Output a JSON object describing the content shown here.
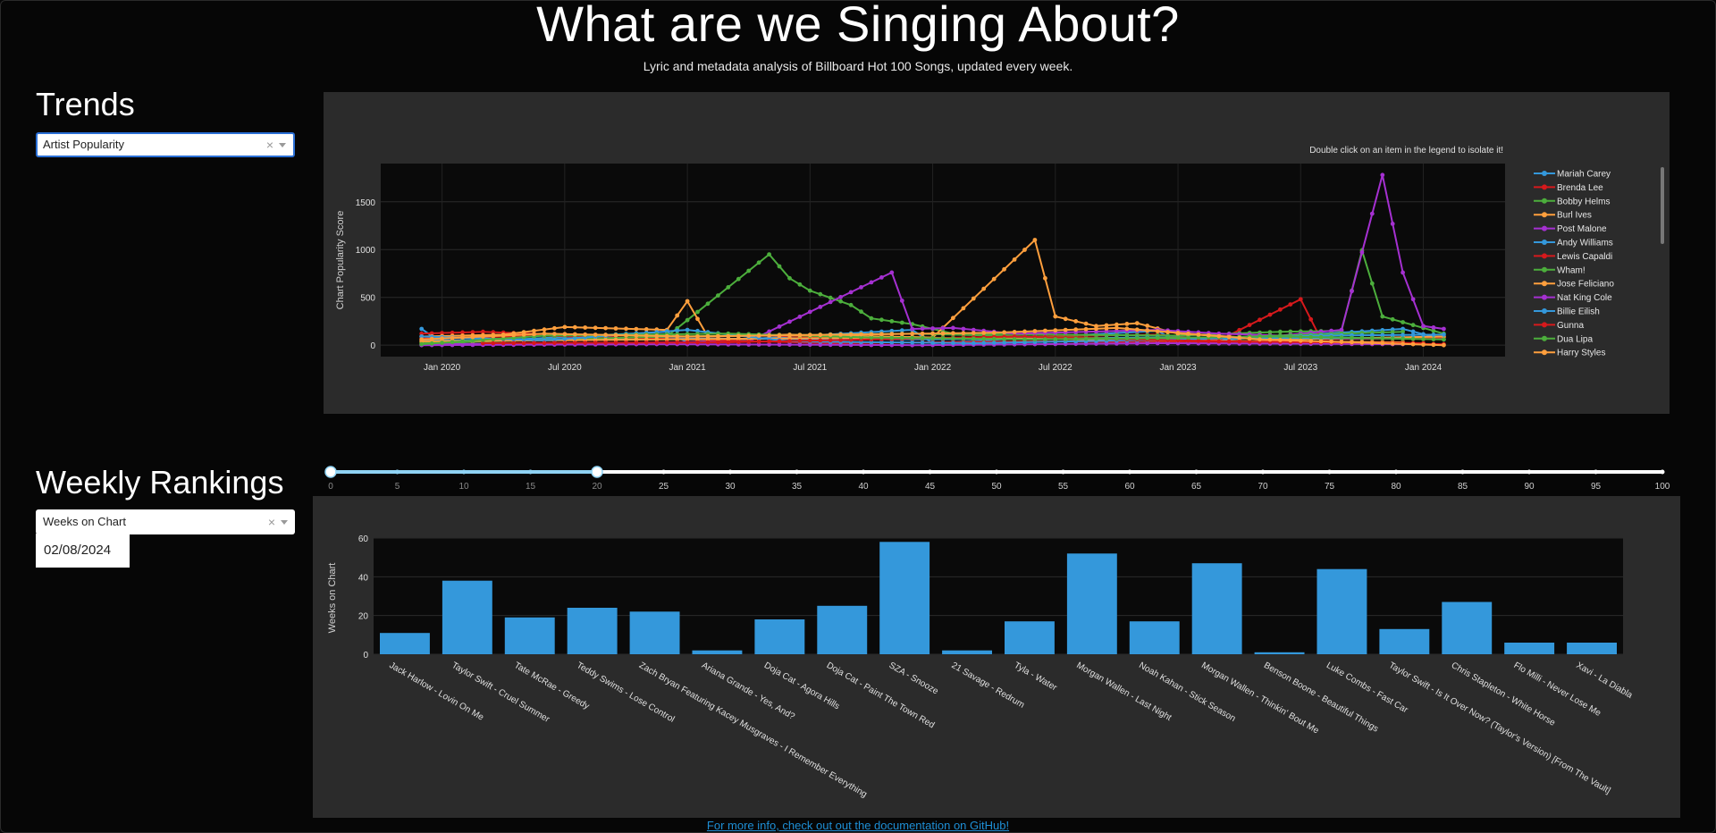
{
  "header": {
    "title": "What are we Singing About?",
    "subtitle": "Lyric and metadata analysis of Billboard Hot 100 Songs, updated every week."
  },
  "trends": {
    "heading": "Trends",
    "dropdown": {
      "value": "Artist Popularity",
      "clear_icon": "×"
    }
  },
  "weekly": {
    "heading": "Weekly Rankings",
    "dropdown": {
      "value": "Weeks on Chart",
      "clear_icon": "×"
    },
    "date": "02/08/2024"
  },
  "slider": {
    "min": 0,
    "max": 100,
    "selected_range": [
      0,
      20
    ],
    "marks": [
      "0",
      "5",
      "10",
      "15",
      "20",
      "25",
      "30",
      "35",
      "40",
      "45",
      "50",
      "55",
      "60",
      "65",
      "70",
      "75",
      "80",
      "85",
      "90",
      "95",
      "100"
    ]
  },
  "footer": {
    "link_text": "For more info, check out out the documentation on GitHub!"
  },
  "colors": {
    "blue": "#3498db",
    "red": "#d7191c",
    "green": "#4cae3c",
    "orange": "#ff9f3d",
    "purple": "#a530d1",
    "accent": "#1e8fd6"
  },
  "chart_data": [
    {
      "type": "line",
      "annotation": "Double click on an item in the legend to isolate it!",
      "ylabel": "Chart Popularity Score",
      "xlabel": "",
      "x_ticks": [
        "Jan 2020",
        "Jul 2020",
        "Jan 2021",
        "Jul 2021",
        "Jan 2022",
        "Jul 2022",
        "Jan 2023",
        "Jul 2023",
        "Jan 2024"
      ],
      "y_ticks": [
        "0",
        "500",
        "1000",
        "1500"
      ],
      "ylim": [
        -120,
        1900
      ],
      "x_range_months": [
        "2019-10",
        "2024-05"
      ],
      "legend_position": "right",
      "series": [
        {
          "name": "Mariah Carey",
          "color": "#3498db",
          "points": [
            [
              "2019-12",
              170
            ],
            [
              "2020-01",
              20
            ],
            [
              "2020-12",
              140
            ],
            [
              "2021-01",
              30
            ],
            [
              "2021-12",
              160
            ],
            [
              "2022-01",
              20
            ],
            [
              "2022-12",
              150
            ],
            [
              "2023-01",
              30
            ],
            [
              "2023-12",
              170
            ],
            [
              "2024-02",
              60
            ]
          ]
        },
        {
          "name": "Brenda Lee",
          "color": "#d7191c",
          "points": [
            [
              "2019-12",
              120
            ],
            [
              "2020-03",
              140
            ],
            [
              "2020-10",
              80
            ],
            [
              "2021-05",
              100
            ],
            [
              "2021-11",
              60
            ],
            [
              "2022-06",
              90
            ],
            [
              "2022-12",
              110
            ],
            [
              "2023-03",
              50
            ],
            [
              "2023-07",
              480
            ],
            [
              "2023-08",
              60
            ],
            [
              "2024-02",
              80
            ]
          ]
        },
        {
          "name": "Bobby Helms",
          "color": "#4cae3c",
          "points": [
            [
              "2019-12",
              30
            ],
            [
              "2020-06",
              60
            ],
            [
              "2020-12",
              90
            ],
            [
              "2021-05",
              950
            ],
            [
              "2021-06",
              700
            ],
            [
              "2021-07",
              570
            ],
            [
              "2021-09",
              420
            ],
            [
              "2021-10",
              280
            ],
            [
              "2021-12",
              220
            ],
            [
              "2022-02",
              120
            ],
            [
              "2022-07",
              110
            ],
            [
              "2023-01",
              100
            ],
            [
              "2023-06",
              140
            ],
            [
              "2023-09",
              150
            ],
            [
              "2023-10",
              990
            ],
            [
              "2023-11",
              300
            ],
            [
              "2024-02",
              120
            ]
          ]
        },
        {
          "name": "Burl Ives",
          "color": "#ff9f3d",
          "points": [
            [
              "2019-12",
              90
            ],
            [
              "2020-04",
              110
            ],
            [
              "2020-07",
              190
            ],
            [
              "2020-12",
              160
            ],
            [
              "2021-01",
              460
            ],
            [
              "2021-02",
              90
            ],
            [
              "2021-06",
              110
            ],
            [
              "2022-01",
              80
            ],
            [
              "2022-06",
              1100
            ],
            [
              "2022-07",
              300
            ],
            [
              "2022-09",
              200
            ],
            [
              "2022-11",
              230
            ],
            [
              "2023-01",
              120
            ],
            [
              "2023-06",
              60
            ],
            [
              "2024-02",
              90
            ]
          ]
        },
        {
          "name": "Post Malone",
          "color": "#a530d1",
          "points": [
            [
              "2019-12",
              10
            ],
            [
              "2020-09",
              20
            ],
            [
              "2021-04",
              40
            ],
            [
              "2021-11",
              760
            ],
            [
              "2021-12",
              170
            ],
            [
              "2022-02",
              180
            ],
            [
              "2022-05",
              120
            ],
            [
              "2022-12",
              160
            ],
            [
              "2023-03",
              120
            ],
            [
              "2023-06",
              100
            ],
            [
              "2023-09",
              160
            ],
            [
              "2023-11",
              1780
            ],
            [
              "2023-12",
              760
            ],
            [
              "2024-01",
              200
            ],
            [
              "2024-02",
              170
            ]
          ]
        },
        {
          "name": "Andy Williams",
          "color": "#3498db",
          "points": [
            [
              "2019-12",
              50
            ],
            [
              "2020-12",
              70
            ],
            [
              "2021-12",
              60
            ],
            [
              "2022-12",
              80
            ],
            [
              "2023-12",
              70
            ]
          ]
        },
        {
          "name": "Lewis Capaldi",
          "color": "#d7191c",
          "points": [
            [
              "2019-12",
              70
            ],
            [
              "2020-06",
              100
            ],
            [
              "2021-01",
              60
            ],
            [
              "2021-08",
              20
            ],
            [
              "2022-06",
              40
            ],
            [
              "2023-02",
              30
            ],
            [
              "2024-02",
              10
            ]
          ]
        },
        {
          "name": "Wham!",
          "color": "#4cae3c",
          "points": [
            [
              "2019-12",
              20
            ],
            [
              "2020-12",
              90
            ],
            [
              "2021-12",
              120
            ],
            [
              "2022-12",
              60
            ],
            [
              "2023-12",
              140
            ]
          ]
        },
        {
          "name": "Jose Feliciano",
          "color": "#ff9f3d",
          "points": [
            [
              "2019-12",
              40
            ],
            [
              "2020-12",
              60
            ],
            [
              "2021-12",
              80
            ],
            [
              "2022-12",
              50
            ],
            [
              "2023-12",
              30
            ]
          ]
        },
        {
          "name": "Nat King Cole",
          "color": "#a530d1",
          "points": [
            [
              "2019-12",
              0
            ],
            [
              "2020-12",
              10
            ],
            [
              "2021-12",
              0
            ],
            [
              "2022-12",
              20
            ],
            [
              "2023-12",
              10
            ]
          ]
        },
        {
          "name": "Billie Eilish",
          "color": "#3498db",
          "points": [
            [
              "2019-12",
              90
            ],
            [
              "2020-06",
              50
            ],
            [
              "2021-01",
              160
            ],
            [
              "2021-06",
              40
            ],
            [
              "2022-03",
              20
            ],
            [
              "2023-01",
              60
            ],
            [
              "2023-08",
              100
            ],
            [
              "2024-02",
              110
            ]
          ]
        },
        {
          "name": "Gunna",
          "color": "#d7191c",
          "points": [
            [
              "2020-03",
              20
            ],
            [
              "2021-03",
              30
            ],
            [
              "2022-05",
              90
            ],
            [
              "2023-03",
              40
            ],
            [
              "2024-01",
              20
            ]
          ]
        },
        {
          "name": "Dua Lipa",
          "color": "#4cae3c",
          "points": [
            [
              "2019-12",
              10
            ],
            [
              "2020-06",
              100
            ],
            [
              "2021-03",
              120
            ],
            [
              "2021-10",
              80
            ],
            [
              "2022-06",
              60
            ],
            [
              "2023-06",
              90
            ],
            [
              "2024-02",
              60
            ]
          ]
        },
        {
          "name": "Harry Styles",
          "color": "#ff9f3d",
          "points": [
            [
              "2019-12",
              60
            ],
            [
              "2020-06",
              120
            ],
            [
              "2021-01",
              90
            ],
            [
              "2022-04",
              130
            ],
            [
              "2022-10",
              180
            ],
            [
              "2023-05",
              60
            ],
            [
              "2024-02",
              0
            ]
          ]
        }
      ]
    },
    {
      "type": "bar",
      "ylabel": "Weeks on Chart",
      "xlabel": "",
      "y_ticks": [
        "0",
        "20",
        "40",
        "60"
      ],
      "ylim": [
        0,
        60
      ],
      "color": "#3498db",
      "categories": [
        "Jack Harlow - Lovin On Me",
        "Taylor Swift - Cruel Summer",
        "Tate McRae - Greedy",
        "Teddy Swims - Lose Control",
        "Zach Bryan Featuring Kacey Musgraves - I Remember Everything",
        "Ariana Grande - Yes, And?",
        "Doja Cat - Agora Hills",
        "Doja Cat - Paint The Town Red",
        "SZA - Snooze",
        "21 Savage - Redrum",
        "Tyla - Water",
        "Morgan Wallen - Last Night",
        "Noah Kahan - Stick Season",
        "Morgan Wallen - Thinkin' Bout Me",
        "Benson Boone - Beautiful Things",
        "Luke Combs - Fast Car",
        "Taylor Swift - Is It Over Now? (Taylor's Version) [From The Vault]",
        "Chris Stapleton - White Horse",
        "Flo Milli - Never Lose Me",
        "Xavi - La Diabla"
      ],
      "values": [
        11,
        38,
        19,
        24,
        22,
        2,
        18,
        25,
        58,
        2,
        17,
        52,
        17,
        47,
        1,
        44,
        13,
        27,
        6,
        6
      ]
    }
  ]
}
